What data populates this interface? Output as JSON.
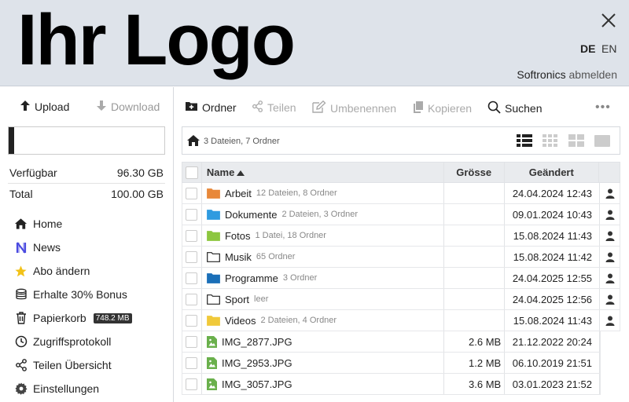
{
  "header": {
    "logo": "Ihr Logo",
    "lang_de": "DE",
    "lang_en": "EN",
    "user": "Softronics",
    "logout": "abmelden"
  },
  "sidebar": {
    "upload": "Upload",
    "download": "Download",
    "quota_used_fraction": 0.037,
    "available_label": "Verfügbar",
    "available_value": "96.30 GB",
    "total_label": "Total",
    "total_value": "100.00 GB",
    "nav": [
      {
        "label": "Home",
        "icon": "home-icon"
      },
      {
        "label": "News",
        "icon": "news-icon"
      },
      {
        "label": "Abo ändern",
        "icon": "star-icon"
      },
      {
        "label": "Erhalte 30% Bonus",
        "icon": "coins-icon"
      },
      {
        "label": "Papierkorb",
        "icon": "trash-icon",
        "badge": "748.2 MB"
      },
      {
        "label": "Zugriffsprotokoll",
        "icon": "clock-icon"
      },
      {
        "label": "Teilen Übersicht",
        "icon": "share-icon"
      },
      {
        "label": "Einstellungen",
        "icon": "gear-icon"
      }
    ]
  },
  "toolbar": {
    "new_folder": "Ordner",
    "share": "Teilen",
    "rename": "Umbenennen",
    "copy": "Kopieren",
    "search": "Suchen",
    "more": "•••"
  },
  "path": {
    "info": "3 Dateien, 7 Ordner"
  },
  "table": {
    "col_name": "Name",
    "col_size": "Grösse",
    "col_date": "Geändert",
    "rows": [
      {
        "name": "Arbeit",
        "info": "12 Dateien, 8 Ordner",
        "size": "",
        "date": "24.04.2024 12:43",
        "type": "folder",
        "color": "#e8883a"
      },
      {
        "name": "Dokumente",
        "info": "2 Dateien, 3 Ordner",
        "size": "",
        "date": "09.01.2024 10:43",
        "type": "folder",
        "color": "#2f9be0"
      },
      {
        "name": "Fotos",
        "info": "1 Datei, 18 Ordner",
        "size": "",
        "date": "15.08.2024 11:43",
        "type": "folder",
        "color": "#8cc63f"
      },
      {
        "name": "Musik",
        "info": "65 Ordner",
        "size": "",
        "date": "15.08.2024 11:42",
        "type": "folder",
        "color": "outline"
      },
      {
        "name": "Programme",
        "info": "3 Ordner",
        "size": "",
        "date": "24.04.2025 12:55",
        "type": "folder",
        "color": "#1a6fb8"
      },
      {
        "name": "Sport",
        "info": "leer",
        "size": "",
        "date": "24.04.2025 12:56",
        "type": "folder",
        "color": "outline"
      },
      {
        "name": "Videos",
        "info": "2 Dateien, 4 Ordner",
        "size": "",
        "date": "15.08.2024 11:43",
        "type": "folder",
        "color": "#f0c93a"
      },
      {
        "name": "IMG_2877.JPG",
        "info": "",
        "size": "2.6 MB",
        "date": "21.12.2022 20:24",
        "type": "file"
      },
      {
        "name": "IMG_2953.JPG",
        "info": "",
        "size": "1.2 MB",
        "date": "06.10.2019 21:51",
        "type": "file"
      },
      {
        "name": "IMG_3057.JPG",
        "info": "",
        "size": "3.6 MB",
        "date": "03.01.2023 21:52",
        "type": "file"
      }
    ]
  }
}
